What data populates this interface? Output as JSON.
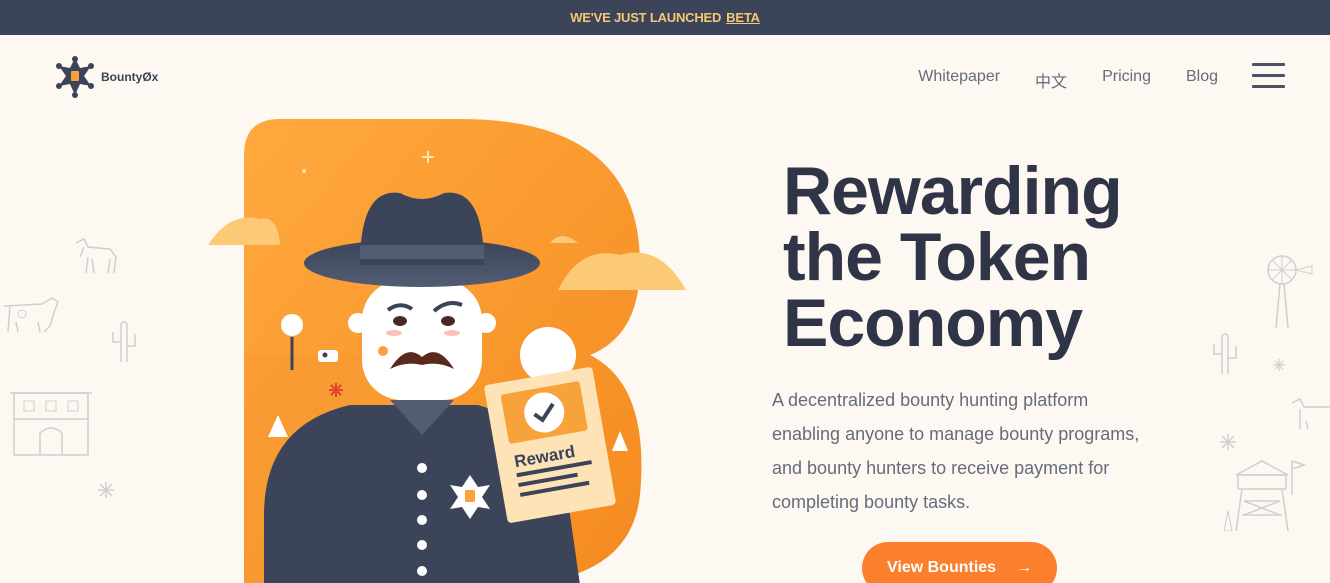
{
  "banner": {
    "text": "WE'VE JUST LAUNCHED",
    "link": "BETA"
  },
  "logo": {
    "name": "BountyØx"
  },
  "nav": {
    "items": [
      "Whitepaper",
      "中文",
      "Pricing",
      "Blog"
    ]
  },
  "hero": {
    "title_line1": "Rewarding",
    "title_line2": "the Token",
    "title_line3": "Economy",
    "description": "A decentralized bounty hunting platform enabling anyone to manage bounty programs, and bounty hunters to receive payment for completing bounty tasks.",
    "cta_label": "View Bounties",
    "cta_icon": "arrow-right-icon"
  },
  "illustration": {
    "reward_card_label": "Reward",
    "badge_letter": "B"
  },
  "colors": {
    "banner_bg": "#3b4458",
    "banner_text": "#f6c876",
    "page_bg": "#fdf8f1",
    "heading": "#2f3547",
    "body_text": "#666c7b",
    "accent": "#fb7f2c",
    "illustration_orange": "#f7a23a"
  }
}
